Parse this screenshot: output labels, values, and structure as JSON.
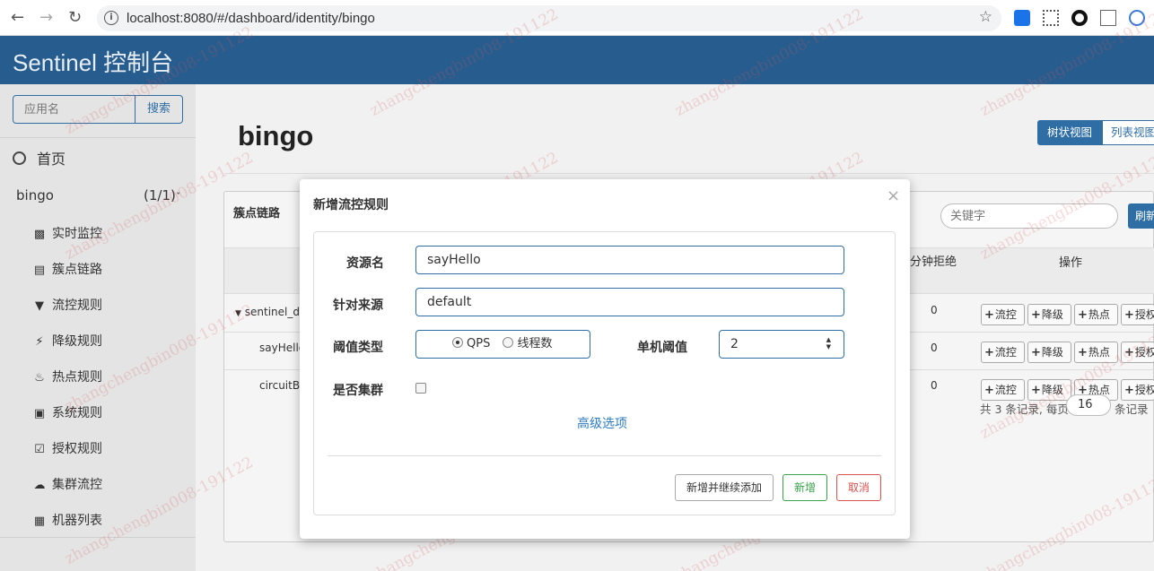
{
  "browser": {
    "url": "localhost:8080/#/dashboard/identity/bingo"
  },
  "app": {
    "brand": "Sentinel 控制台"
  },
  "sidebar": {
    "search_placeholder": "应用名",
    "search_button": "搜索",
    "home": "首页",
    "app_name": "bingo",
    "app_count": "(1/1)",
    "items": [
      {
        "icon": "bar-chart-icon",
        "label": "实时监控"
      },
      {
        "icon": "list-icon",
        "label": "簇点链路"
      },
      {
        "icon": "filter-icon",
        "label": "流控规则"
      },
      {
        "icon": "flash-icon",
        "label": "降级规则"
      },
      {
        "icon": "fire-icon",
        "label": "热点规则"
      },
      {
        "icon": "lock-icon",
        "label": "系统规则"
      },
      {
        "icon": "check-icon",
        "label": "授权规则"
      },
      {
        "icon": "cloud-icon",
        "label": "集群流控"
      },
      {
        "icon": "grid-icon",
        "label": "机器列表"
      }
    ]
  },
  "main": {
    "title": "bingo",
    "view_tree": "树状视图",
    "view_list": "列表视图",
    "chain_title": "簇点链路",
    "keyword_placeholder": "关键字",
    "refresh_label": "刷新",
    "col_reject": "分钟拒绝",
    "col_ops": "操作",
    "rows": [
      {
        "name": "sentinel_de",
        "reject": "0"
      },
      {
        "name": "sayHello",
        "reject": "0"
      },
      {
        "name": "circuitBre",
        "reject": "0"
      }
    ],
    "op_labels": [
      "流控",
      "降级",
      "热点",
      "授权"
    ],
    "pager_prefix": "共 3 条记录, 每页",
    "page_size": "16",
    "pager_suffix": "条记录"
  },
  "modal": {
    "title": "新增流控规则",
    "close": "×",
    "resource_label": "资源名",
    "resource_value": "sayHello",
    "origin_label": "针对来源",
    "origin_value": "default",
    "grade_label": "阈值类型",
    "grade_qps": "QPS",
    "grade_thread": "线程数",
    "threshold_label": "单机阈值",
    "threshold_value": "2",
    "cluster_label": "是否集群",
    "advanced_link": "高级选项",
    "btn_save_continue": "新增并继续添加",
    "btn_add": "新增",
    "btn_cancel": "取消"
  },
  "watermark": "zhangchengbin008-191122"
}
